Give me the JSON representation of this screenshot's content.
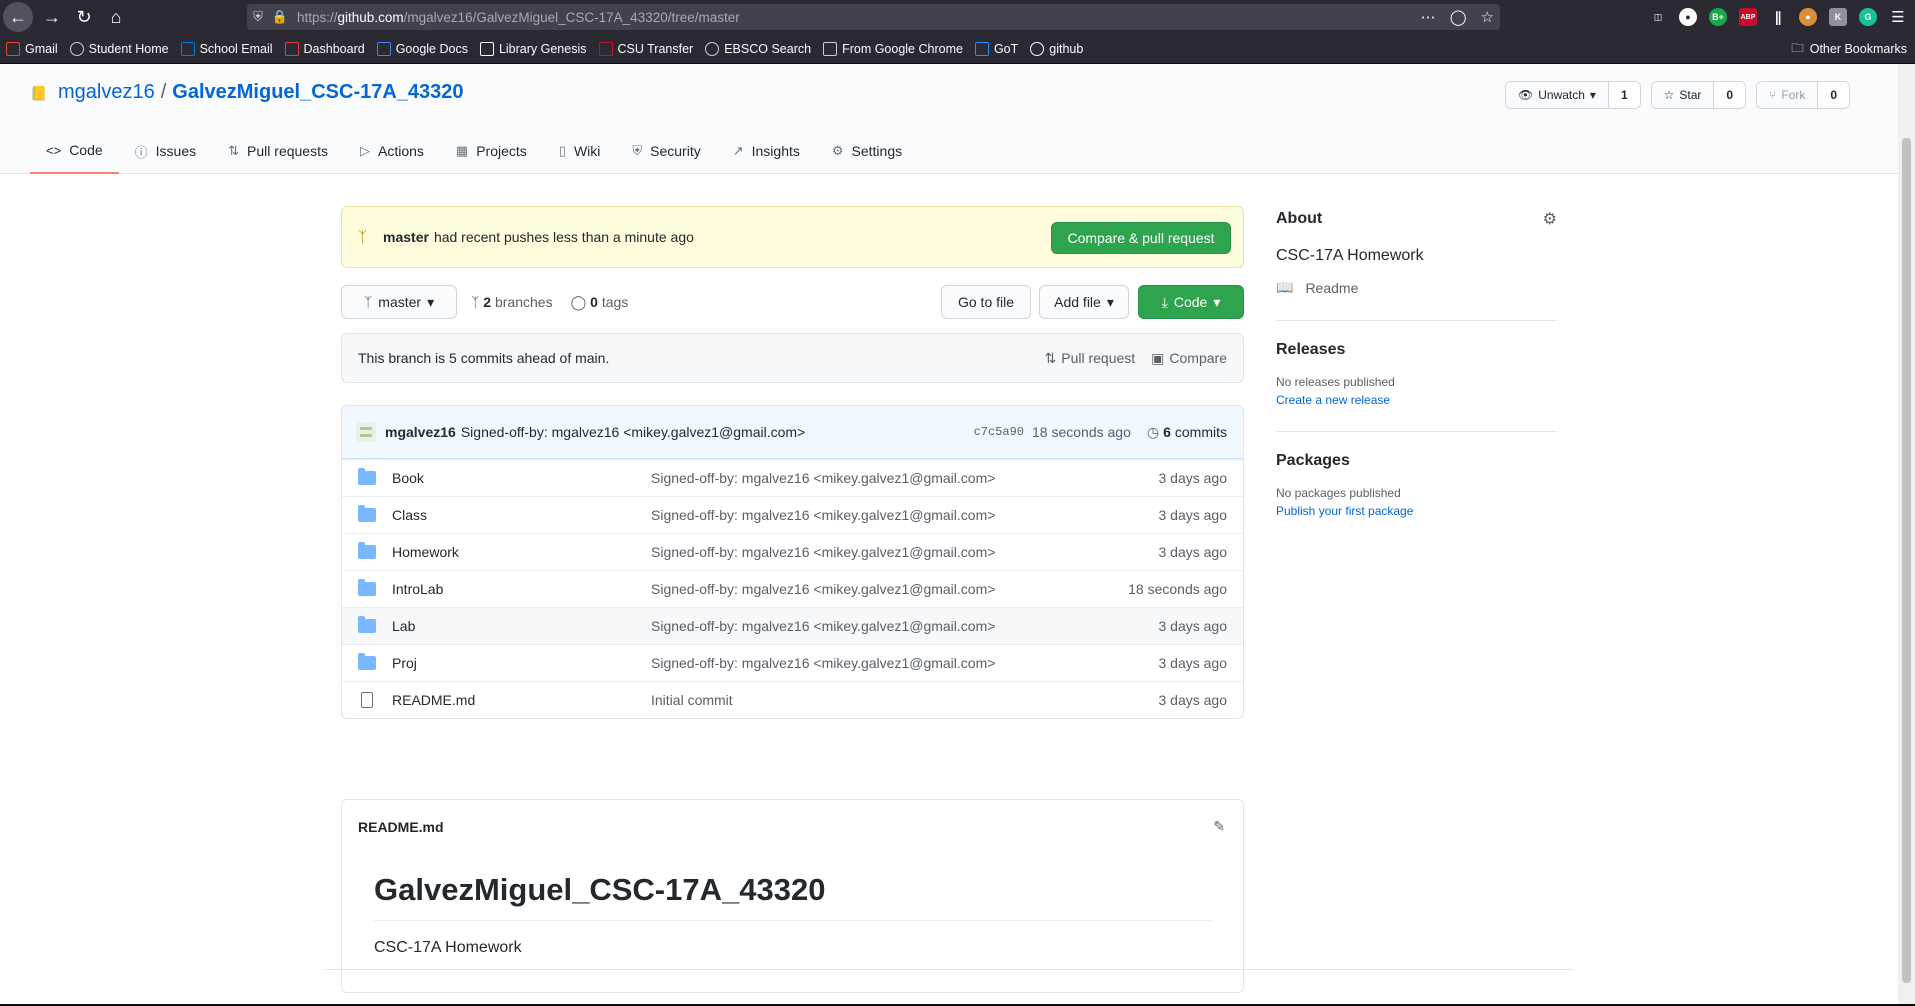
{
  "browser": {
    "url_prefix": "https://",
    "url_host": "github.com",
    "url_path": "/mgalvez16/GalvezMiguel_CSC-17A_43320/tree/master",
    "bookmarks": [
      {
        "label": "Gmail",
        "icon": "gmail-icon",
        "color": "#ea4335"
      },
      {
        "label": "Student Home",
        "icon": "globe-icon",
        "color": "#cfcfd8"
      },
      {
        "label": "School Email",
        "icon": "outlook-icon",
        "color": "#0078d4"
      },
      {
        "label": "Dashboard",
        "icon": "canvas-icon",
        "color": "#e13c3c"
      },
      {
        "label": "Google Docs",
        "icon": "docs-icon",
        "color": "#4285f4"
      },
      {
        "label": "Library Genesis",
        "icon": "book-icon",
        "color": "#ffffff"
      },
      {
        "label": "CSU Transfer",
        "icon": "csu-icon",
        "color": "#c4122f"
      },
      {
        "label": "EBSCO Search",
        "icon": "globe-icon",
        "color": "#cfcfd8"
      },
      {
        "label": "From Google Chrome",
        "icon": "folder-icon",
        "color": "#cfcfd8"
      },
      {
        "label": "GoT",
        "icon": "got-icon",
        "color": "#1f8fff"
      },
      {
        "label": "github",
        "icon": "github-icon",
        "color": "#ffffff"
      }
    ],
    "other_bookmarks": "Other Bookmarks"
  },
  "repo": {
    "owner": "mgalvez16",
    "separator": "/",
    "name": "GalvezMiguel_CSC-17A_43320",
    "unwatch_label": "Unwatch",
    "watch_count": "1",
    "star_label": "Star",
    "star_count": "0",
    "fork_label": "Fork",
    "fork_count": "0"
  },
  "tabs": [
    {
      "label": "Code",
      "icon": "code-icon"
    },
    {
      "label": "Issues",
      "icon": "issue-icon"
    },
    {
      "label": "Pull requests",
      "icon": "pull-request-icon"
    },
    {
      "label": "Actions",
      "icon": "play-icon"
    },
    {
      "label": "Projects",
      "icon": "project-icon"
    },
    {
      "label": "Wiki",
      "icon": "book-icon"
    },
    {
      "label": "Security",
      "icon": "shield-icon"
    },
    {
      "label": "Insights",
      "icon": "graph-icon"
    },
    {
      "label": "Settings",
      "icon": "gear-icon"
    }
  ],
  "flash": {
    "branch": "master",
    "text": "had recent pushes less than a minute ago",
    "button": "Compare & pull request"
  },
  "branch_bar": {
    "branch": "master",
    "branches_count": "2",
    "branches_label": "branches",
    "tags_count": "0",
    "tags_label": "tags",
    "goto_file": "Go to file",
    "add_file": "Add file",
    "code": "Code"
  },
  "ahead": {
    "text": "This branch is 5 commits ahead of main.",
    "pull_request": "Pull request",
    "compare": "Compare"
  },
  "latest_commit": {
    "author": "mgalvez16",
    "message": "Signed-off-by: mgalvez16 <mikey.galvez1@gmail.com>",
    "sha": "c7c5a90",
    "age": "18 seconds ago",
    "commits_count": "6",
    "commits_label": "commits"
  },
  "files": [
    {
      "name": "Book",
      "type": "folder",
      "message": "Signed-off-by: mgalvez16 <mikey.galvez1@gmail.com>",
      "age": "3 days ago"
    },
    {
      "name": "Class",
      "type": "folder",
      "message": "Signed-off-by: mgalvez16 <mikey.galvez1@gmail.com>",
      "age": "3 days ago"
    },
    {
      "name": "Homework",
      "type": "folder",
      "message": "Signed-off-by: mgalvez16 <mikey.galvez1@gmail.com>",
      "age": "3 days ago"
    },
    {
      "name": "IntroLab",
      "type": "folder",
      "message": "Signed-off-by: mgalvez16 <mikey.galvez1@gmail.com>",
      "age": "18 seconds ago"
    },
    {
      "name": "Lab",
      "type": "folder",
      "message": "Signed-off-by: mgalvez16 <mikey.galvez1@gmail.com>",
      "age": "3 days ago"
    },
    {
      "name": "Proj",
      "type": "folder",
      "message": "Signed-off-by: mgalvez16 <mikey.galvez1@gmail.com>",
      "age": "3 days ago"
    },
    {
      "name": "README.md",
      "type": "file",
      "message": "Initial commit",
      "age": "3 days ago"
    }
  ],
  "readme": {
    "filename": "README.md",
    "heading": "GalvezMiguel_CSC-17A_43320",
    "body": "CSC-17A Homework"
  },
  "sidebar": {
    "about_title": "About",
    "description": "CSC-17A Homework",
    "readme_label": "Readme",
    "releases_title": "Releases",
    "no_releases": "No releases published",
    "create_release": "Create a new release",
    "packages_title": "Packages",
    "no_packages": "No packages published",
    "publish_package": "Publish your first package"
  },
  "colors": {
    "link": "#0366d6",
    "green": "#2ea44f",
    "flash_bg": "#fffbdd",
    "active_tab": "#f9826c"
  }
}
